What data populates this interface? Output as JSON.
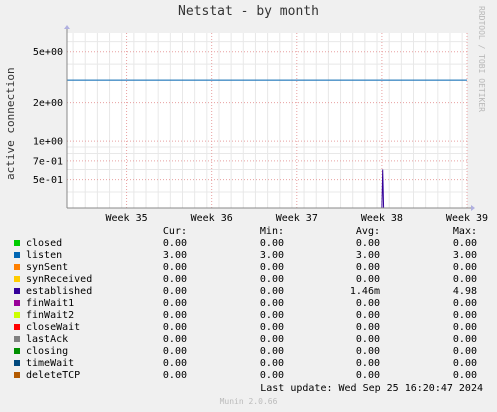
{
  "title": "Netstat - by month",
  "watermark": "RRDTOOL / TOBI OETIKER",
  "munin_version": "Munin 2.0.66",
  "last_update": "Last update: Wed Sep 25 16:20:47 2024",
  "legend_headers": {
    "cur": "Cur:",
    "min": "Min:",
    "avg": "Avg:",
    "max": "Max:"
  },
  "colors": {
    "plot_bg": "#ffffff",
    "grid_major": "#e8a0a0",
    "grid_minor": "#e8e8e8",
    "axis": "#888888"
  },
  "chart_data": {
    "type": "line",
    "title": "Netstat - by month",
    "ylabel": "active connection",
    "yscale": "log",
    "ylim": [
      0.3,
      7
    ],
    "y_ticks": [
      {
        "value": 5,
        "label": "5e+00"
      },
      {
        "value": 2,
        "label": "2e+00"
      },
      {
        "value": 1,
        "label": "1e+00"
      },
      {
        "value": 0.7,
        "label": "7e-01"
      },
      {
        "value": 0.5,
        "label": "5e-01"
      }
    ],
    "xlim": [
      34.3,
      39
    ],
    "x_ticks": [
      {
        "value": 35,
        "label": "Week 35"
      },
      {
        "value": 36,
        "label": "Week 36"
      },
      {
        "value": 37,
        "label": "Week 37"
      },
      {
        "value": 38,
        "label": "Week 38"
      },
      {
        "value": 39,
        "label": "Week 39"
      }
    ],
    "grid": true,
    "series": [
      {
        "name": "closed",
        "color": "#00cc00",
        "cur": "0.00",
        "min": "0.00",
        "avg": "0.00",
        "max": "0.00"
      },
      {
        "name": "listen",
        "color": "#0066b3",
        "cur": "3.00",
        "min": "3.00",
        "avg": "3.00",
        "max": "3.00",
        "points": [
          [
            34.3,
            3.0
          ],
          [
            39.0,
            3.0
          ]
        ]
      },
      {
        "name": "synSent",
        "color": "#ff8000",
        "cur": "0.00",
        "min": "0.00",
        "avg": "0.00",
        "max": "0.00"
      },
      {
        "name": "synReceived",
        "color": "#ffcc00",
        "cur": "0.00",
        "min": "0.00",
        "avg": "0.00",
        "max": "0.00"
      },
      {
        "name": "established",
        "color": "#330099",
        "cur": "0.00",
        "min": "0.00",
        "avg": "1.46m",
        "max": "4.98",
        "points": [
          [
            38.0,
            0.3
          ],
          [
            38.01,
            0.6
          ],
          [
            38.02,
            0.3
          ]
        ]
      },
      {
        "name": "finWait1",
        "color": "#990099",
        "cur": "0.00",
        "min": "0.00",
        "avg": "0.00",
        "max": "0.00"
      },
      {
        "name": "finWait2",
        "color": "#ccff00",
        "cur": "0.00",
        "min": "0.00",
        "avg": "0.00",
        "max": "0.00"
      },
      {
        "name": "closeWait",
        "color": "#ff0000",
        "cur": "0.00",
        "min": "0.00",
        "avg": "0.00",
        "max": "0.00"
      },
      {
        "name": "lastAck",
        "color": "#808080",
        "cur": "0.00",
        "min": "0.00",
        "avg": "0.00",
        "max": "0.00"
      },
      {
        "name": "closing",
        "color": "#008f00",
        "cur": "0.00",
        "min": "0.00",
        "avg": "0.00",
        "max": "0.00"
      },
      {
        "name": "timeWait",
        "color": "#00487d",
        "cur": "0.00",
        "min": "0.00",
        "avg": "0.00",
        "max": "0.00"
      },
      {
        "name": "deleteTCP",
        "color": "#b35a00",
        "cur": "0.00",
        "min": "0.00",
        "avg": "0.00",
        "max": "0.00"
      }
    ]
  }
}
